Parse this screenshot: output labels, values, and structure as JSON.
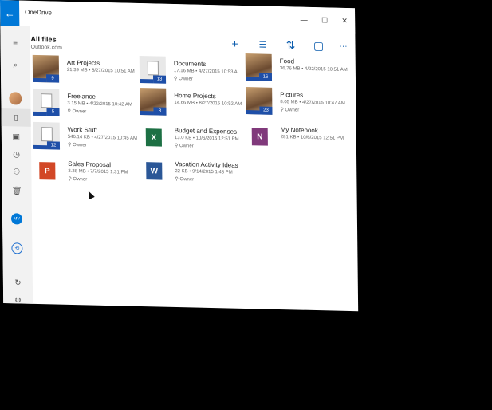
{
  "window": {
    "app_title": "OneDrive",
    "back_glyph": "←",
    "controls": [
      "—",
      "☐",
      "✕"
    ]
  },
  "sidebar": {
    "menu_glyph": "≡",
    "search_glyph": "⌕",
    "files_glyph": "▯",
    "photos_glyph": "▣",
    "recent_glyph": "◷",
    "shared_glyph": "⚇",
    "recycle_glyph": "🗑",
    "account_initials": "MV",
    "onedrive_glyph": "⟲",
    "sync_glyph": "↻",
    "settings_glyph": "⚙"
  },
  "header": {
    "title": "All files",
    "subtitle": "Outlook.com"
  },
  "toolbar": {
    "add_glyph": "+",
    "select_glyph": "☰",
    "sort_glyph": "⇅",
    "view_glyph": "▢",
    "more_glyph": "···"
  },
  "files": [
    {
      "name": "Art Projects",
      "meta": "21.39 MB • 8/27/2015 10:51 AM",
      "owner": "",
      "count": "9",
      "kind": "photo"
    },
    {
      "name": "Documents",
      "meta": "17.16 MB • 4/27/2015 10:53 A",
      "owner": "Owner",
      "count": "13",
      "kind": "folder"
    },
    {
      "name": "Food",
      "meta": "36.76 MB • 4/22/2015 10:51 AM",
      "owner": "",
      "count": "16",
      "kind": "photo"
    },
    {
      "name": "Freelance",
      "meta": "3.15 MB • 4/22/2015 10:42 AM",
      "owner": "Owner",
      "count": "5",
      "kind": "folder"
    },
    {
      "name": "Home Projects",
      "meta": "14.66 MB • 8/27/2015 10:52 AM",
      "owner": "",
      "count": "8",
      "kind": "photo"
    },
    {
      "name": "Pictures",
      "meta": "8.05 MB • 4/27/2015 10:47 AM",
      "owner": "Owner",
      "count": "23",
      "kind": "photo"
    },
    {
      "name": "Work Stuff",
      "meta": "546.14 KB • 4/27/2015 10:45 AM",
      "owner": "Owner",
      "count": "12",
      "kind": "folder"
    },
    {
      "name": "Budget and Expenses",
      "meta": "13.0 KB • 10/6/2015 12:51 PM",
      "owner": "Owner",
      "count": "",
      "kind": "excel"
    },
    {
      "name": "My Notebook",
      "meta": "281 KB • 10/6/2015 12:51 PM",
      "owner": "",
      "count": "",
      "kind": "onenote"
    },
    {
      "name": "Sales Proposal",
      "meta": "3.38 MB • 7/7/2015 1:31 PM",
      "owner": "Owner",
      "count": "",
      "kind": "powerpoint"
    },
    {
      "name": "Vacation Activity Ideas",
      "meta": "22 KB • 9/14/2015 1:48 PM",
      "owner": "Owner",
      "count": "",
      "kind": "word"
    }
  ],
  "doc_letters": {
    "excel": "X",
    "word": "W",
    "powerpoint": "P",
    "onenote": "N"
  },
  "owner_glyph": "⚲",
  "colors": {
    "accent": "#0078d7",
    "tile_badge": "#1e4fa8",
    "excel": "#1d7044",
    "word": "#2b5797",
    "powerpoint": "#d24726",
    "onenote": "#80397b"
  }
}
